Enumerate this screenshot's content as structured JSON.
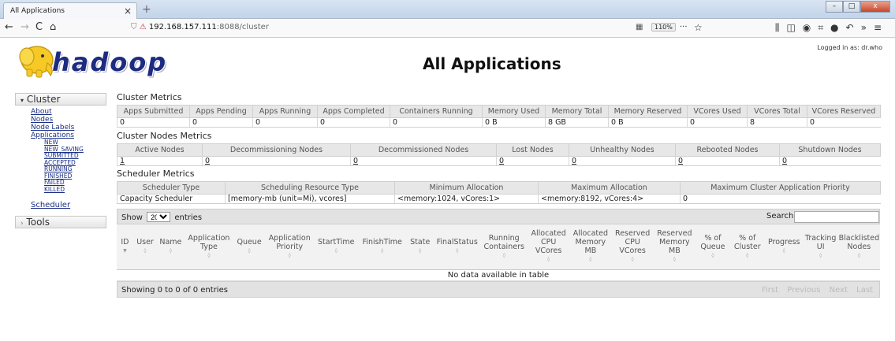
{
  "browser": {
    "tab_title": "All Applications",
    "tab_close": "×",
    "new_tab": "+",
    "url_host": "192.168.157.111",
    "url_rest": ":8088/cluster",
    "zoom": "110%",
    "more": "···",
    "back": "←",
    "forward": "→",
    "reload": "C",
    "home": "⌂",
    "window_min": "–",
    "window_max": "□",
    "window_close": "x"
  },
  "header": {
    "logo_text": "hadoop",
    "title": "All Applications",
    "logged_in": "Logged in as: dr.who"
  },
  "sidebar": {
    "cluster_label": "Cluster",
    "cluster_toggle": "▾",
    "links": [
      "About",
      "Nodes",
      "Node Labels",
      "Applications"
    ],
    "app_states": [
      "NEW",
      "NEW_SAVING",
      "SUBMITTED",
      "ACCEPTED",
      "RUNNING",
      "FINISHED",
      "FAILED",
      "KILLED"
    ],
    "scheduler_label": "Scheduler",
    "tools_label": "Tools",
    "tools_toggle": "›"
  },
  "cluster_metrics": {
    "title": "Cluster Metrics",
    "headers": [
      "Apps Submitted",
      "Apps Pending",
      "Apps Running",
      "Apps Completed",
      "Containers Running",
      "Memory Used",
      "Memory Total",
      "Memory Reserved",
      "VCores Used",
      "VCores Total",
      "VCores Reserved"
    ],
    "values": [
      "0",
      "0",
      "0",
      "0",
      "0",
      "0 B",
      "8 GB",
      "0 B",
      "0",
      "8",
      "0"
    ]
  },
  "node_metrics": {
    "title": "Cluster Nodes Metrics",
    "headers": [
      "Active Nodes",
      "Decommissioning Nodes",
      "Decommissioned Nodes",
      "Lost Nodes",
      "Unhealthy Nodes",
      "Rebooted Nodes",
      "Shutdown Nodes"
    ],
    "values": [
      "1",
      "0",
      "0",
      "0",
      "0",
      "0",
      "0"
    ]
  },
  "scheduler_metrics": {
    "title": "Scheduler Metrics",
    "headers": [
      "Scheduler Type",
      "Scheduling Resource Type",
      "Minimum Allocation",
      "Maximum Allocation",
      "Maximum Cluster Application Priority"
    ],
    "values": [
      "Capacity Scheduler",
      "[memory-mb (unit=Mi), vcores]",
      "<memory:1024, vCores:1>",
      "<memory:8192, vCores:4>",
      "0"
    ]
  },
  "apps_table": {
    "show_label": "Show",
    "page_size": "20",
    "entries_label": "entries",
    "search_label": "Search:",
    "columns": [
      "ID",
      "User",
      "Name",
      "Application Type",
      "Queue",
      "Application Priority",
      "StartTime",
      "FinishTime",
      "State",
      "FinalStatus",
      "Running Containers",
      "Allocated CPU VCores",
      "Allocated Memory MB",
      "Reserved CPU VCores",
      "Reserved Memory MB",
      "% of Queue",
      "% of Cluster",
      "Progress",
      "Tracking UI",
      "Blacklisted Nodes"
    ],
    "empty_message": "No data available in table",
    "info": "Showing 0 to 0 of 0 entries",
    "pager": [
      "First",
      "Previous",
      "Next",
      "Last"
    ]
  }
}
